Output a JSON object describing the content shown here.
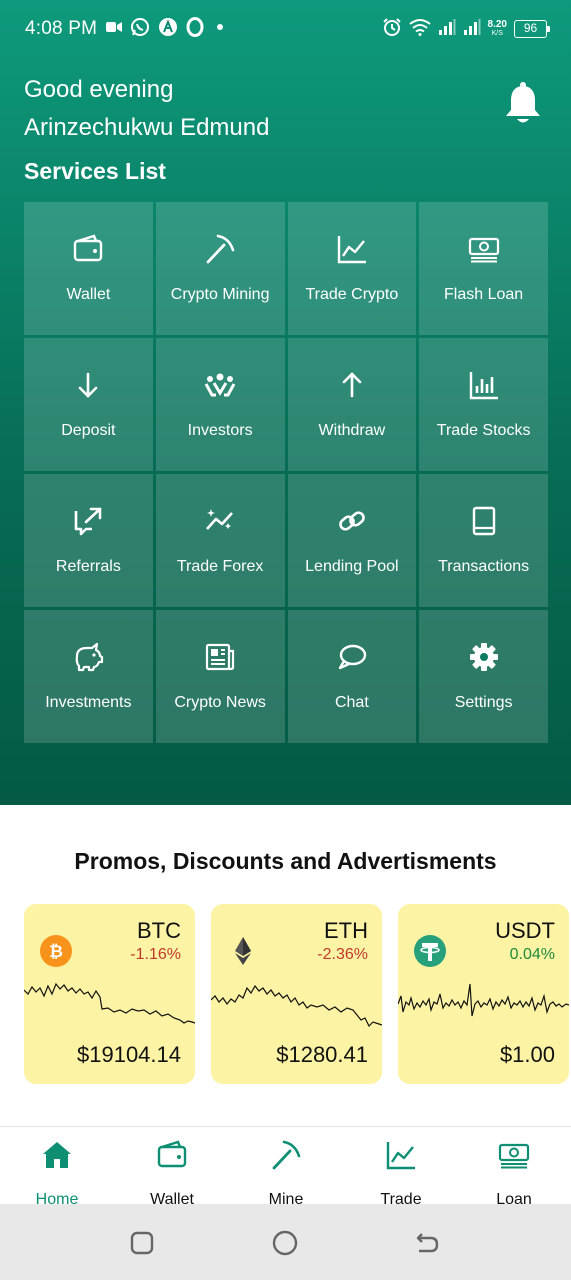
{
  "status_bar": {
    "time": "4:08 PM",
    "net_speed_value": "8.20",
    "net_speed_unit": "K/S",
    "battery": "96"
  },
  "greeting": "Good evening",
  "username": "Arinzechukwu Edmund",
  "services_title": "Services List",
  "services": [
    {
      "label": "Wallet",
      "icon": "wallet-icon"
    },
    {
      "label": "Crypto Mining",
      "icon": "pickaxe-icon"
    },
    {
      "label": "Trade Crypto",
      "icon": "line-chart-icon"
    },
    {
      "label": "Flash Loan",
      "icon": "banknote-icon"
    },
    {
      "label": "Deposit",
      "icon": "arrow-down-icon"
    },
    {
      "label": "Investors",
      "icon": "investors-icon"
    },
    {
      "label": "Withdraw",
      "icon": "arrow-up-icon"
    },
    {
      "label": "Trade Stocks",
      "icon": "bar-chart-icon"
    },
    {
      "label": "Referrals",
      "icon": "share-icon"
    },
    {
      "label": "Trade Forex",
      "icon": "sparkle-chart-icon"
    },
    {
      "label": "Lending Pool",
      "icon": "link-icon"
    },
    {
      "label": "Transactions",
      "icon": "book-icon"
    },
    {
      "label": "Investments",
      "icon": "piggy-bank-icon"
    },
    {
      "label": "Crypto News",
      "icon": "newspaper-icon"
    },
    {
      "label": "Chat",
      "icon": "chat-bubble-icon"
    },
    {
      "label": "Settings",
      "icon": "gear-icon"
    }
  ],
  "promo_title": "Promos, Discounts and Advertisments",
  "coins": [
    {
      "symbol": "BTC",
      "change": "-1.16%",
      "price": "$19104.14",
      "icon": "bitcoin-icon",
      "color": "#f7931a",
      "change_color": "#c0392b"
    },
    {
      "symbol": "ETH",
      "change": "-2.36%",
      "price": "$1280.41",
      "icon": "ethereum-icon",
      "color": "#627eea",
      "change_color": "#c0392b"
    },
    {
      "symbol": "USDT",
      "change": "0.04%",
      "price": "$1.00",
      "icon": "tether-icon",
      "color": "#26a17b",
      "change_color": "#1e8a3c"
    }
  ],
  "bottom_nav": [
    {
      "label": "Home",
      "icon": "home-icon",
      "active": true
    },
    {
      "label": "Wallet",
      "icon": "wallet-icon",
      "active": false
    },
    {
      "label": "Mine",
      "icon": "pickaxe-icon",
      "active": false
    },
    {
      "label": "Trade",
      "icon": "line-chart-icon",
      "active": false
    },
    {
      "label": "Loan",
      "icon": "banknote-icon",
      "active": false
    }
  ],
  "colors": {
    "header_top": "#0e9a7c",
    "header_bottom": "#045a44",
    "accent": "#0e8f74",
    "card_bg": "#fcf4a4",
    "negative": "#c0392b",
    "positive": "#1e8a3c"
  }
}
